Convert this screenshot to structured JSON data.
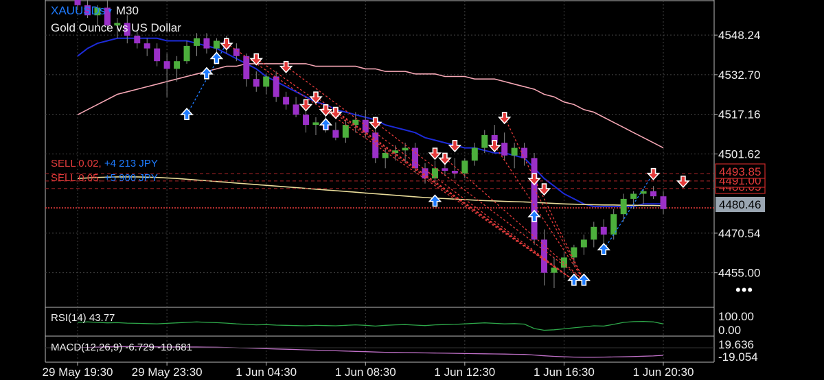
{
  "header": {
    "symbol": "XAUUSDs",
    "caret": "▾",
    "timeframe": "M30",
    "description": "Gold Ounce vs US Dollar"
  },
  "trades": [
    {
      "side": "SELL 0.02,",
      "pl": "+4 213 JPY"
    },
    {
      "side": "SELL 0.05,",
      "pl": "+5 900 JPY"
    }
  ],
  "indicators": {
    "rsi_label": "RSI(14) 43.77",
    "macd_label": "MACD(12,26,9) -6.729 -10.681"
  },
  "more_icon": "more-dots-icon",
  "colors": {
    "bull": "#4caf3c",
    "bear": "#9b30c8",
    "ma_fast": "#1d2bd8",
    "ma_slow": "#f4a6b4",
    "ma_long": "#e9dc9a",
    "buy_arrow": "#1e7bff",
    "sell_arrow": "#e43b3b",
    "current_price": "#9aa6b2",
    "rsi_line": "#2ea84a",
    "macd_line": "#c070c8"
  },
  "chart_data": {
    "type": "candlestick",
    "y_axis_ticks": [
      "4548.24",
      "4532.70",
      "4517.16",
      "4501.62",
      "4470.54",
      "4455.00"
    ],
    "price_tags": {
      "sell_1": "4493.85",
      "sell_2": "4491.00",
      "sell_3": "4488.05",
      "current": "4480.46"
    },
    "levels": [
      4493.85,
      4491.0,
      4488.05,
      4480.46
    ],
    "x_axis_ticks": [
      "29 May 19:30",
      "29 May 23:30",
      "1 Jun 04:30",
      "1 Jun 08:30",
      "1 Jun 12:30",
      "1 Jun 16:30",
      "1 Jun 20:30"
    ],
    "ylim": [
      4442,
      4562
    ],
    "ohlc": [
      [
        4568,
        4570,
        4558,
        4560
      ],
      [
        4560,
        4564,
        4555,
        4556
      ],
      [
        4556,
        4560,
        4552,
        4559
      ],
      [
        4559,
        4562,
        4550,
        4552
      ],
      [
        4552,
        4555,
        4547,
        4553
      ],
      [
        4553,
        4556,
        4545,
        4548
      ],
      [
        4548,
        4550,
        4543,
        4545
      ],
      [
        4545,
        4547,
        4540,
        4543
      ],
      [
        4543,
        4545,
        4536,
        4538
      ],
      [
        4538,
        4541,
        4524,
        4535
      ],
      [
        4535,
        4540,
        4530,
        4538
      ],
      [
        4538,
        4546,
        4537,
        4544
      ],
      [
        4544,
        4549,
        4540,
        4547
      ],
      [
        4547,
        4549,
        4541,
        4543
      ],
      [
        4543,
        4547,
        4540,
        4546
      ],
      [
        4546,
        4548,
        4541,
        4543
      ],
      [
        4543,
        4545,
        4538,
        4540
      ],
      [
        4540,
        4541,
        4528,
        4531
      ],
      [
        4531,
        4534,
        4526,
        4528
      ],
      [
        4528,
        4533,
        4525,
        4532
      ],
      [
        4532,
        4534,
        4522,
        4524
      ],
      [
        4524,
        4526,
        4519,
        4521
      ],
      [
        4521,
        4524,
        4516,
        4517
      ],
      [
        4517,
        4520,
        4510,
        4513
      ],
      [
        4513,
        4516,
        4509,
        4514
      ],
      [
        4514,
        4517,
        4510,
        4511
      ],
      [
        4511,
        4514,
        4507,
        4508
      ],
      [
        4508,
        4515,
        4506,
        4513
      ],
      [
        4513,
        4518,
        4510,
        4515
      ],
      [
        4515,
        4519,
        4508,
        4510
      ],
      [
        4510,
        4513,
        4498,
        4500
      ],
      [
        4500,
        4504,
        4496,
        4502
      ],
      [
        4502,
        4505,
        4499,
        4503
      ],
      [
        4503,
        4506,
        4498,
        4504
      ],
      [
        4504,
        4506,
        4494,
        4496
      ],
      [
        4496,
        4498,
        4490,
        4492
      ],
      [
        4492,
        4499,
        4490,
        4496
      ],
      [
        4496,
        4498,
        4493,
        4495
      ],
      [
        4495,
        4500,
        4492,
        4494
      ],
      [
        4494,
        4500,
        4492,
        4499
      ],
      [
        4499,
        4506,
        4497,
        4504
      ],
      [
        4504,
        4511,
        4502,
        4509
      ],
      [
        4509,
        4513,
        4504,
        4506
      ],
      [
        4506,
        4510,
        4499,
        4501
      ],
      [
        4501,
        4506,
        4496,
        4504
      ],
      [
        4504,
        4506,
        4497,
        4500
      ],
      [
        4500,
        4502,
        4466,
        4468
      ],
      [
        4468,
        4472,
        4450,
        4455
      ],
      [
        4455,
        4461,
        4449,
        4457
      ],
      [
        4457,
        4463,
        4453,
        4461
      ],
      [
        4461,
        4466,
        4458,
        4465
      ],
      [
        4465,
        4470,
        4462,
        4468
      ],
      [
        4468,
        4475,
        4465,
        4473
      ],
      [
        4473,
        4476,
        4466,
        4470
      ],
      [
        4470,
        4480,
        4468,
        4478
      ],
      [
        4478,
        4486,
        4475,
        4484
      ],
      [
        4484,
        4487,
        4480,
        4486
      ],
      [
        4486,
        4488,
        4482,
        4487
      ],
      [
        4487,
        4489,
        4484,
        4485
      ],
      [
        4485,
        4487,
        4478,
        4480
      ]
    ],
    "series": [
      {
        "values": [
          4540,
          4543,
          4545,
          4546,
          4547,
          4547,
          4547,
          4547,
          4547,
          4546,
          4546,
          4546,
          4545,
          4544,
          4543,
          4541,
          4539,
          4537,
          4535,
          4532,
          4530,
          4528,
          4526,
          4524,
          4522,
          4521,
          4519,
          4518,
          4517,
          4516,
          4515,
          4513,
          4512,
          4511,
          4510,
          4508,
          4507,
          4506,
          4505,
          4504,
          4504,
          4503,
          4502,
          4502,
          4501,
          4500,
          4496,
          4492,
          4489,
          4486,
          4484,
          4482,
          4481,
          4481,
          4481,
          4481,
          4481,
          4482,
          4482,
          4482
        ]
      },
      {
        "values": [
          4517,
          4519,
          4521,
          4523,
          4525,
          4526,
          4527,
          4528,
          4529,
          4530,
          4531,
          4532,
          4533,
          4534,
          4535,
          4536,
          4536,
          4537,
          4537,
          4537,
          4537,
          4537,
          4537,
          4537,
          4536,
          4536,
          4536,
          4536,
          4536,
          4535,
          4535,
          4534,
          4534,
          4534,
          4533,
          4533,
          4533,
          4532,
          4532,
          4532,
          4531,
          4531,
          4531,
          4530,
          4529,
          4528,
          4527,
          4525,
          4524,
          4522,
          4521,
          4519,
          4518,
          4516,
          4514,
          4512,
          4510,
          4508,
          4506,
          4504
        ]
      },
      {
        "values": [
          4492,
          4492.2,
          4492.4,
          4492.5,
          4492.6,
          4492.6,
          4492.6,
          4492.5,
          4492.4,
          4492.2,
          4492,
          4491.7,
          4491.4,
          4491.1,
          4490.8,
          4490.5,
          4490.2,
          4489.9,
          4489.6,
          4489.3,
          4489,
          4488.7,
          4488.4,
          4488.1,
          4487.8,
          4487.5,
          4487.2,
          4486.9,
          4486.6,
          4486.3,
          4486,
          4485.7,
          4485.4,
          4485.1,
          4484.8,
          4484.5,
          4484.3,
          4484.1,
          4483.9,
          4483.7,
          4483.5,
          4483.3,
          4483.2,
          4483,
          4482.9,
          4482.8,
          4482.6,
          4482.4,
          4482.2,
          4482,
          4481.9,
          4481.8,
          4481.7,
          4481.6,
          4481.6,
          4481.5,
          4481.5,
          4481.4,
          4481.4,
          4481.3
        ]
      }
    ],
    "buy_signals": [
      [
        11,
        4517
      ],
      [
        13,
        4533
      ],
      [
        14,
        4539
      ],
      [
        25,
        4513
      ],
      [
        36,
        4483
      ],
      [
        50,
        4452
      ],
      [
        51,
        4452
      ],
      [
        53,
        4464
      ],
      [
        46,
        4477
      ]
    ],
    "sell_signals": [
      [
        15,
        4545
      ],
      [
        18,
        4539
      ],
      [
        21,
        4536
      ],
      [
        23,
        4521
      ],
      [
        24,
        4524
      ],
      [
        25,
        4519
      ],
      [
        26,
        4518
      ],
      [
        30,
        4514
      ],
      [
        36,
        4502
      ],
      [
        37,
        4500
      ],
      [
        38,
        4505
      ],
      [
        42,
        4505
      ],
      [
        43,
        4516
      ],
      [
        46,
        4492
      ],
      [
        47,
        4488
      ],
      [
        58,
        4494
      ],
      [
        61,
        4491
      ]
    ],
    "trade_links": [
      [
        11,
        4517,
        15,
        4545
      ],
      [
        15,
        4545,
        50,
        4452
      ],
      [
        18,
        4539,
        50,
        4452
      ],
      [
        21,
        4536,
        50,
        4452
      ],
      [
        24,
        4524,
        50,
        4452
      ],
      [
        26,
        4518,
        50,
        4452
      ],
      [
        30,
        4514,
        51,
        4452
      ],
      [
        37,
        4500,
        51,
        4452
      ],
      [
        42,
        4505,
        51,
        4452
      ],
      [
        43,
        4516,
        51,
        4452
      ],
      [
        46,
        4488,
        51,
        4452
      ],
      [
        53,
        4464,
        58,
        4494
      ]
    ],
    "rsi": {
      "ticks": [
        "100.00",
        "0.00"
      ],
      "values": [
        0.5,
        0.52,
        0.5,
        0.48,
        0.49,
        0.47,
        0.46,
        0.45,
        0.44,
        0.46,
        0.48,
        0.5,
        0.52,
        0.5,
        0.49,
        0.47,
        0.44,
        0.42,
        0.4,
        0.41,
        0.39,
        0.38,
        0.37,
        0.36,
        0.38,
        0.37,
        0.36,
        0.38,
        0.4,
        0.38,
        0.35,
        0.38,
        0.4,
        0.41,
        0.39,
        0.37,
        0.4,
        0.41,
        0.42,
        0.44,
        0.46,
        0.48,
        0.46,
        0.44,
        0.45,
        0.43,
        0.25,
        0.18,
        0.2,
        0.24,
        0.28,
        0.32,
        0.36,
        0.35,
        0.42,
        0.5,
        0.53,
        0.54,
        0.52,
        0.44
      ]
    },
    "macd": {
      "ticks": [
        "19.636",
        "-19.054"
      ],
      "values": [
        0.0,
        0.02,
        0.04,
        0.06,
        0.07,
        0.08,
        0.08,
        0.07,
        0.06,
        0.05,
        0.05,
        0.05,
        0.05,
        0.04,
        0.03,
        0.02,
        0.0,
        -0.02,
        -0.04,
        -0.06,
        -0.08,
        -0.1,
        -0.12,
        -0.14,
        -0.16,
        -0.18,
        -0.2,
        -0.22,
        -0.24,
        -0.26,
        -0.28,
        -0.3,
        -0.31,
        -0.32,
        -0.33,
        -0.34,
        -0.35,
        -0.36,
        -0.37,
        -0.38,
        -0.39,
        -0.4,
        -0.41,
        -0.42,
        -0.43,
        -0.44,
        -0.48,
        -0.53,
        -0.57,
        -0.6,
        -0.62,
        -0.63,
        -0.63,
        -0.62,
        -0.61,
        -0.6,
        -0.58,
        -0.56,
        -0.54,
        -0.5
      ]
    }
  }
}
